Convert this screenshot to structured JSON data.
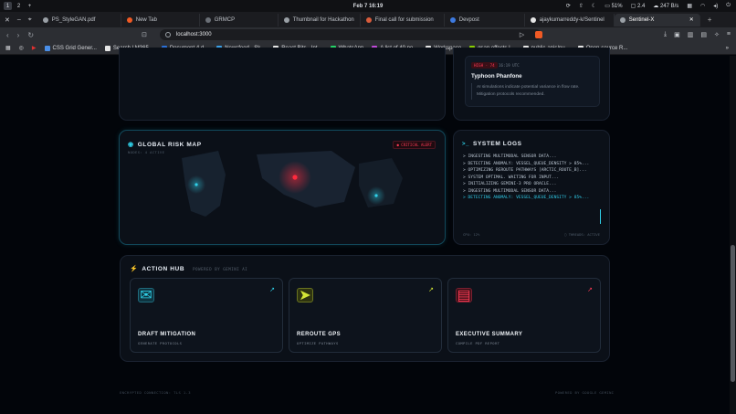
{
  "system_bar": {
    "workspaces": [
      "1",
      "2",
      "+"
    ],
    "clock": "Feb 7  16:19",
    "battery": "51%",
    "monitor": "2.4",
    "network": "247 B/s"
  },
  "tabs": [
    {
      "label": "PS_StyleGAN.pdf",
      "color": "#9aa0a6",
      "active": false
    },
    {
      "label": "New Tab",
      "color": "#f05a24",
      "active": false
    },
    {
      "label": "GRMCP",
      "color": "#6a6f76",
      "active": false
    },
    {
      "label": "Thumbnail for Hackathon",
      "color": "#9aa0a6",
      "active": false
    },
    {
      "label": "Final call for submission",
      "color": "#d85c3c",
      "active": false
    },
    {
      "label": "Devpost",
      "color": "#3d7ae0",
      "active": false
    },
    {
      "label": "ajaykumarreddy-k/Sentinel",
      "color": "#e6e6e6",
      "active": false
    },
    {
      "label": "Sentinel-X",
      "color": "#9aa0a6",
      "active": true
    }
  ],
  "address": {
    "url": "localhost:3000"
  },
  "bookmarks": [
    {
      "label": "CSS Grid Gener...",
      "color": "#4a8fe8"
    },
    {
      "label": "Search | M365...",
      "color": "#e6e6e6"
    },
    {
      "label": "Document 4.d...",
      "color": "#2b6fd6"
    },
    {
      "label": "Newsfeed - Sk...",
      "color": "#3aa0e8"
    },
    {
      "label": "React Bits - Int...",
      "color": "#e6e6e6"
    },
    {
      "label": "WhatsApp",
      "color": "#25d366"
    },
    {
      "label": "A list of 40 po...",
      "color": "#c04ad8"
    },
    {
      "label": "Workspace",
      "color": "#e6e6e6"
    },
    {
      "label": "gsap.effects |...",
      "color": "#88ce02"
    },
    {
      "label": "public-apis/pu...",
      "color": "#e6e6e6"
    },
    {
      "label": "Open-source R...",
      "color": "#e6e6e6"
    }
  ],
  "alert": {
    "badge": "HIGH · 74",
    "time": "16:19 UTC",
    "title": "Typhoon Phanfone",
    "body": "AI simulations indicate potential variance in flow rate. Mitigation protocols recommended."
  },
  "risk_map": {
    "title": "GLOBAL RISK MAP",
    "subtitle": "NODES: 4 ACTIVE",
    "badge": "CRITICAL ALERT",
    "colors": {
      "critical": "#ff2a3d",
      "normal": "#2fd0e8"
    }
  },
  "system_logs": {
    "title": "SYSTEM LOGS",
    "lines": [
      {
        "text": "> INGESTING MULTIMODAL SENSOR DATA...",
        "highlight": false
      },
      {
        "text": "> DETECTING ANOMALY: VESSEL_QUEUE_DENSITY > 85%...",
        "highlight": false
      },
      {
        "text": "> OPTIMIZING REROUTE PATHWAYS [ARCTIC_ROUTE_B]...",
        "highlight": false
      },
      {
        "text": "> SYSTEM OPTIMAL. WAITING FOR INPUT...",
        "highlight": false
      },
      {
        "text": "> INITIALIZING GEMINI-3 PRO ORACLE...",
        "highlight": false
      },
      {
        "text": "> INGESTING MULTIMODAL SENSOR DATA...",
        "highlight": false
      },
      {
        "text": "> DETECTING ANOMALY: VESSEL_QUEUE_DENSITY > 85%...",
        "highlight": true
      }
    ],
    "cpu": "CPU: 12%",
    "threads": "THREADS: ACTIVE"
  },
  "action_hub": {
    "title": "ACTION HUB",
    "powered": "POWERED BY GEMINI AI",
    "cards": [
      {
        "title": "DRAFT MITIGATION",
        "subtitle": "GENERATE PROTOCOLS",
        "accent": "#2fd0e8"
      },
      {
        "title": "REROUTE GPS",
        "subtitle": "OPTIMIZE PATHWAYS",
        "accent": "#d4e636"
      },
      {
        "title": "EXECUTIVE SUMMARY",
        "subtitle": "COMPILE PDF REPORT",
        "accent": "#ff3b56"
      }
    ]
  },
  "footer": {
    "left": "ENCRYPTED CONNECTION: TLS 1.3",
    "right": "POWERED BY GOOGLE GEMINI"
  }
}
